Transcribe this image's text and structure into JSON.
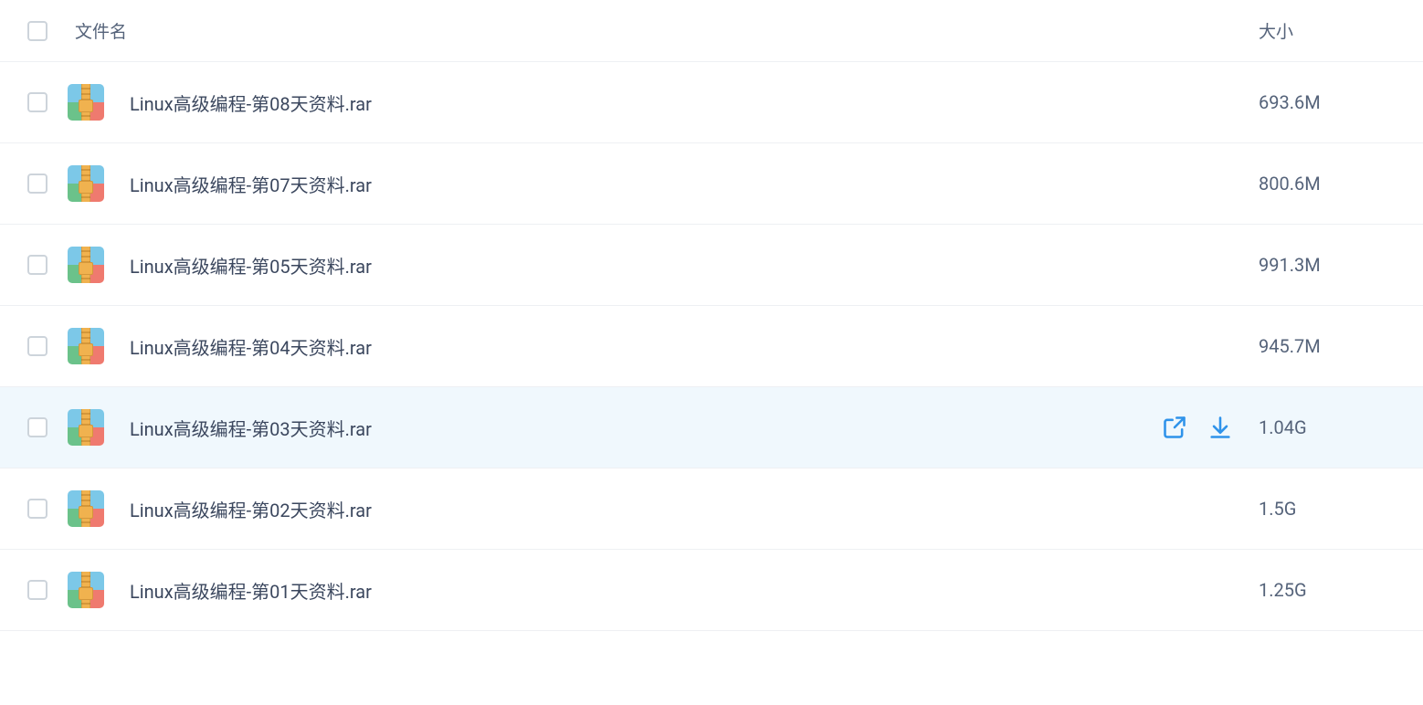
{
  "header": {
    "name_label": "文件名",
    "size_label": "大小"
  },
  "files": [
    {
      "name": "Linux高级编程-第08天资料.rar",
      "size": "693.6M",
      "hovered": false
    },
    {
      "name": "Linux高级编程-第07天资料.rar",
      "size": "800.6M",
      "hovered": false
    },
    {
      "name": "Linux高级编程-第05天资料.rar",
      "size": "991.3M",
      "hovered": false
    },
    {
      "name": "Linux高级编程-第04天资料.rar",
      "size": "945.7M",
      "hovered": false
    },
    {
      "name": "Linux高级编程-第03天资料.rar",
      "size": "1.04G",
      "hovered": true
    },
    {
      "name": "Linux高级编程-第02天资料.rar",
      "size": "1.5G",
      "hovered": false
    },
    {
      "name": "Linux高级编程-第01天资料.rar",
      "size": "1.25G",
      "hovered": false
    }
  ],
  "icons": {
    "share": "share-icon",
    "download": "download-icon"
  }
}
